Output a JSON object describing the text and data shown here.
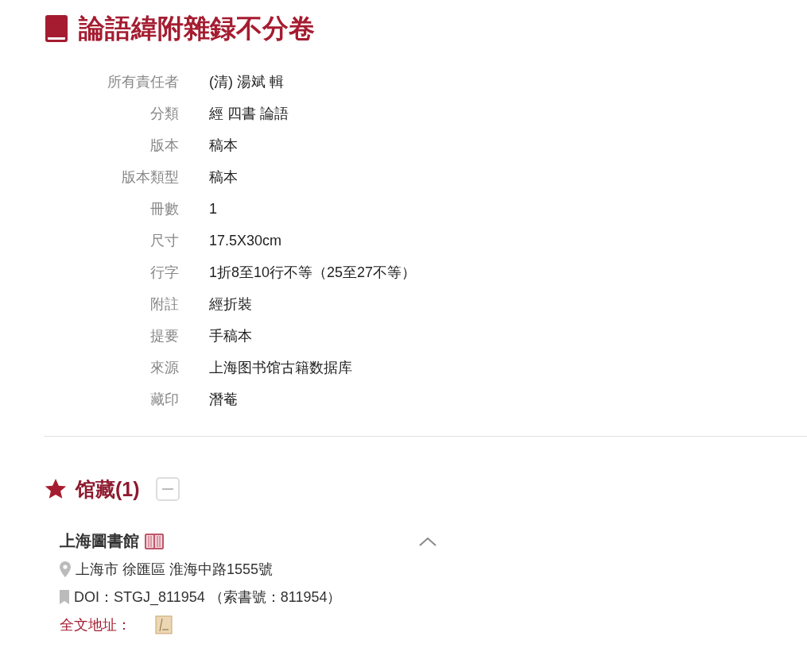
{
  "title": "論語緯附雜録不分卷",
  "fields": [
    {
      "label": "所有責任者",
      "value": "(清) 湯斌  輯"
    },
    {
      "label": "分類",
      "value": "經 四書 論語"
    },
    {
      "label": "版本",
      "value": "稿本"
    },
    {
      "label": "版本類型",
      "value": "稿本"
    },
    {
      "label": "冊數",
      "value": "1"
    },
    {
      "label": "尺寸",
      "value": "17.5X30cm"
    },
    {
      "label": "行字",
      "value": "1折8至10行不等（25至27不等）"
    },
    {
      "label": "附註",
      "value": "經折裝"
    },
    {
      "label": "提要",
      "value": "手稿本"
    },
    {
      "label": "來源",
      "value": "上海图书馆古籍数据库"
    },
    {
      "label": "藏印",
      "value": "潛菴"
    }
  ],
  "holdings": {
    "title": "馆藏(1)",
    "expanded": true,
    "items": [
      {
        "name": "上海圖書館",
        "expanded": true,
        "address": "上海市 徐匯區 淮海中路1555號",
        "doi": "DOI：STGJ_811954 （索書號：811954）",
        "fulltext_label": "全文地址："
      }
    ]
  }
}
